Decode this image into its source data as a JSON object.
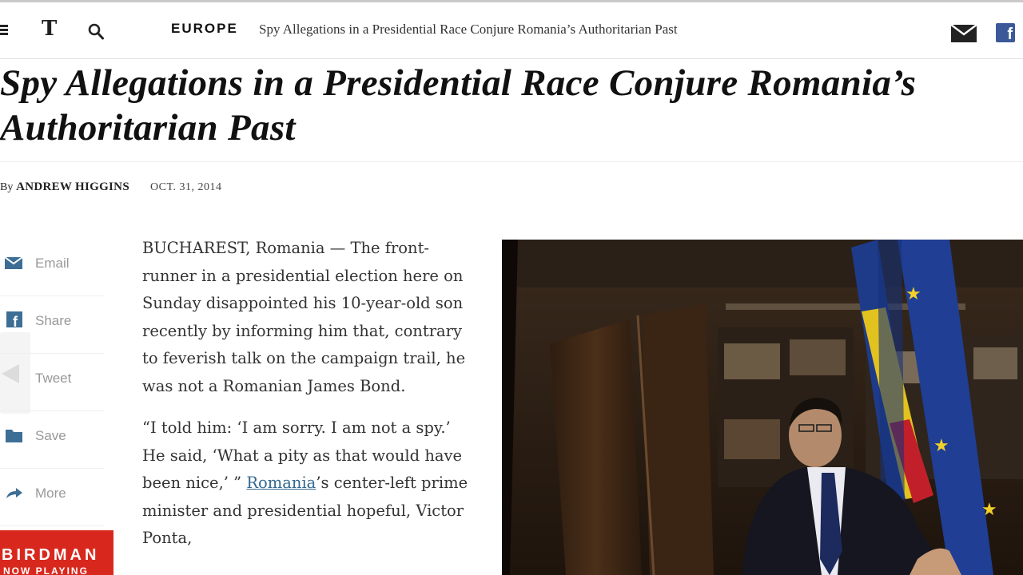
{
  "header": {
    "section": "EUROPE",
    "headline": "Spy Allegations in a Presidential Race Conjure Romania’s Authoritarian Past",
    "logo_letter": "T",
    "fb_letter": "f"
  },
  "article": {
    "title": "Spy Allegations in a Presidential Race Conjure Romania’s Authoritarian Past",
    "byline_prefix": "By",
    "author": "ANDREW HIGGINS",
    "date": "OCT. 31, 2014",
    "para1": "BUCHAREST, Romania — The front-runner in a presidential election here on Sunday disappointed his 10-year-old son recently by informing him that, contrary to feverish talk on the campaign trail, he was not a Romanian James Bond.",
    "para2_start": "“I told him: ‘I am sorry. I am not a spy.’ He said, ‘What a pity as that would have been nice,’ ” ",
    "para2_link": "Romania",
    "para2_end": "’s center-left prime minister and presidential hopeful, Victor Ponta,"
  },
  "share": {
    "email": "Email",
    "share": "Share",
    "tweet": "Tweet",
    "save": "Save",
    "more": "More"
  },
  "ad": {
    "title": "BIRDMAN",
    "subtitle": "NOW PLAYING"
  },
  "icons": {
    "menu": "hamburger-icon",
    "logo": "nyt-t-logo",
    "search": "search-icon",
    "mail": "mail-icon",
    "facebook": "facebook-icon",
    "share_email": "envelope-icon",
    "share_facebook": "facebook-icon",
    "share_tweet": "tweet-icon",
    "share_save": "folder-icon",
    "share_more": "arrow-icon"
  },
  "colors": {
    "link": "#326891",
    "facebook": "#3b5998",
    "ad_red": "#d8281e",
    "share_icon": "#3d6e95"
  }
}
